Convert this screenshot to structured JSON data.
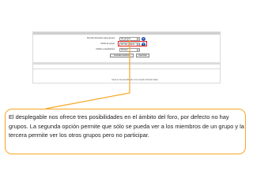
{
  "settings": {
    "row1": {
      "label": "Permitir discusión para grupos",
      "value": "No grupos"
    },
    "row2": {
      "label": "Modo de grupo",
      "value": "No hay grupos"
    },
    "row3": {
      "label": "Visible a estudiantes",
      "value": "Mostrar"
    },
    "save_label": "Guardar cambios",
    "cancel_label": "Cancelar",
    "footer": "Usted se ha autentificado como Usuario Chamilo (Salir)"
  },
  "callout": {
    "text": "El desplegable nos ofrece tres posibilidades en el ámbito del foro, por defecto no hay grupos. La segunda opción permite que sólo se pueda ver a los miembros de un grupo y la tercera permite ver los otros grupos pero no participar."
  },
  "colors": {
    "highlight": "#e02020",
    "callout_border": "#f5a623",
    "help_icon": "#2b5bb5"
  },
  "icons": {
    "help": "help-icon",
    "dropdown": "chevron-down-icon"
  }
}
